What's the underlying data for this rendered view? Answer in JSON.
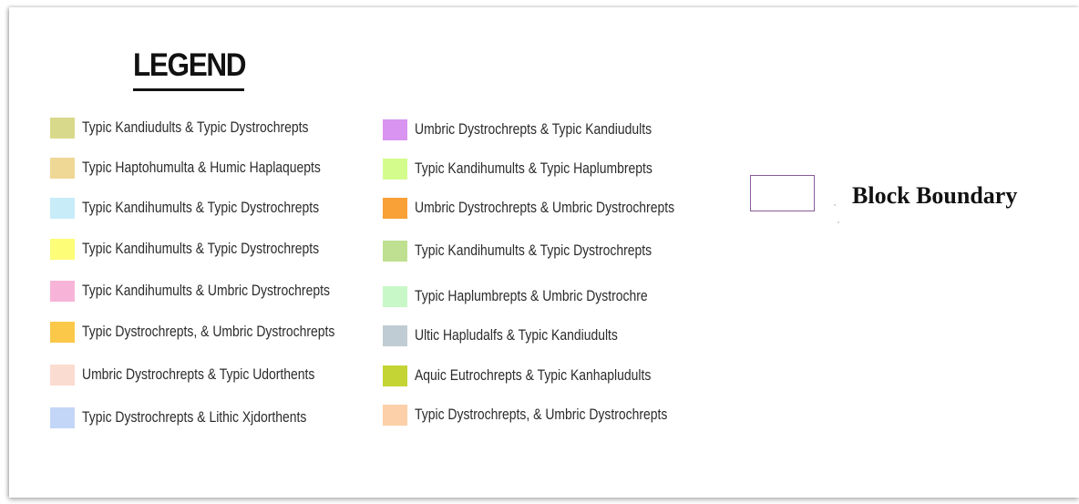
{
  "legend": {
    "title": "LEGEND",
    "column1": [
      {
        "label": "Typic Kandiudults & Typic Dystrochrepts",
        "color": "#d9d98c"
      },
      {
        "label": "Typic Haptohumulta & Humic Haplaquepts",
        "color": "#efd795"
      },
      {
        "label": "Typic Kandihumults & Typic Dystrochrepts",
        "color": "#c8ecf8"
      },
      {
        "label": "Typic Kandihumults & Typic Dystrochrepts",
        "color": "#fdfd78"
      },
      {
        "label": "Typic Kandihumults & Umbric Dystrochrepts",
        "color": "#f8b4d8"
      },
      {
        "label": "Typic Dystrochrepts, & Umbric Dystrochrepts",
        "color": "#fbc84a"
      },
      {
        "label": "Umbric Dystrochrepts & Typic Udorthents",
        "color": "#fbdcd0"
      },
      {
        "label": "Typic Dystrochrepts & Lithic Xjdorthents",
        "color": "#c4d6f8"
      }
    ],
    "column2": [
      {
        "label": "Umbric Dystrochrepts & Typic Kandiudults",
        "color": "#d894f0"
      },
      {
        "label": "Typic Kandihumults & Typic Haplumbrepts",
        "color": "#d4fc8c"
      },
      {
        "label": "Umbric Dystrochrepts & Umbric Dystrochrepts",
        "color": "#f9a036"
      },
      {
        "label": "Typic Kandihumults & Typic Dystrochrepts",
        "color": "#bfe090"
      },
      {
        "label": "Typic Haplumbrepts & Umbric Dystrochre",
        "color": "#c8f8c8"
      },
      {
        "label": "Ultic Hapludalfs & Typic Kandiudults",
        "color": "#c0ccd4"
      },
      {
        "label": "Aquic Eutrochrepts & Typic Kanhapludults",
        "color": "#c4d434"
      },
      {
        "label": "Typic Dystrochrepts, & Umbric Dystrochrepts",
        "color": "#fcd0a8"
      }
    ],
    "boundary": {
      "label": "Block Boundary",
      "color": "#8a5a98"
    }
  }
}
